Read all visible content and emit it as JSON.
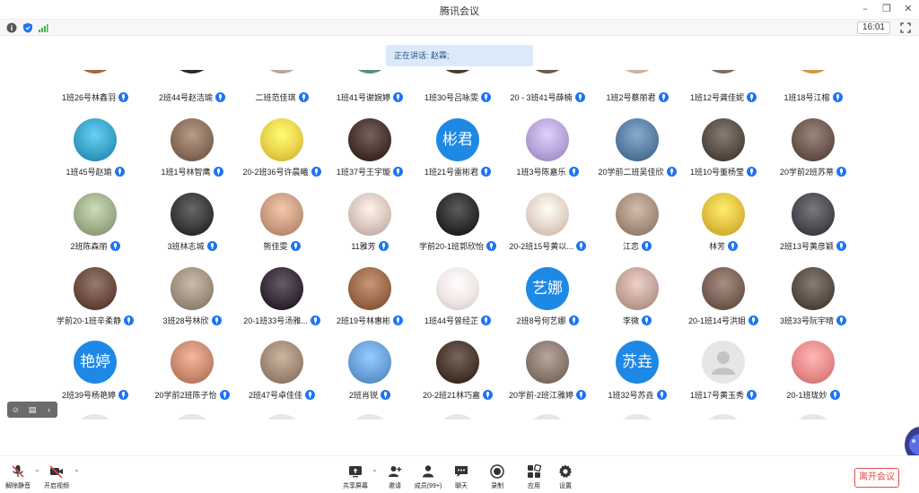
{
  "window": {
    "title": "腾讯会议",
    "minimize": "–",
    "restore": "❐",
    "close": "✕"
  },
  "status": {
    "time": "16:01"
  },
  "speaking": "正在讲话: 赵霖;",
  "colors": {
    "accent": "#1d74f5",
    "leave": "#e64a4a",
    "speaking_bg": "#dbe9fb"
  },
  "participants": [
    {
      "name": "1班26号林鑫羽",
      "avatar": "photo",
      "color": "#b9774a"
    },
    {
      "name": "2班44号赵洁瑜",
      "avatar": "photo",
      "color": "#3a3a3a"
    },
    {
      "name": "二班范佳琪",
      "avatar": "photo",
      "color": "#c5b9a6"
    },
    {
      "name": "1班41号谢婉婷",
      "avatar": "photo",
      "color": "#6e9b8c"
    },
    {
      "name": "1班30号吕咏雯",
      "avatar": "photo",
      "color": "#5a4a3d"
    },
    {
      "name": "20 - 3班41号薛楠",
      "avatar": "photo",
      "color": "#7c6a5e"
    },
    {
      "name": "1班2号蔡丽君",
      "avatar": "photo",
      "color": "#d9c2b0"
    },
    {
      "name": "1班12号龚佳妮",
      "avatar": "photo",
      "color": "#8f7f6d"
    },
    {
      "name": "1班18号江榕",
      "avatar": "photo",
      "color": "#e0a85a"
    },
    {
      "name": "1班45号赵瑜",
      "avatar": "photo",
      "color": "#3aa3c9"
    },
    {
      "name": "1班1号林智鹰",
      "avatar": "photo",
      "color": "#8b6f5d"
    },
    {
      "name": "20-2班36号许晨曦",
      "avatar": "photo",
      "color": "#e9d24a"
    },
    {
      "name": "1班37号王宇璇",
      "avatar": "photo",
      "color": "#4a3630"
    },
    {
      "name": "1班21号雷彬君",
      "avatar": "text",
      "text": "彬君"
    },
    {
      "name": "1班3号陈嘉乐",
      "avatar": "photo",
      "color": "#b4a4d9"
    },
    {
      "name": "20学前二班吴佳欣",
      "avatar": "photo",
      "color": "#5a7fa3"
    },
    {
      "name": "1班10号董杨莹",
      "avatar": "photo",
      "color": "#5a5048"
    },
    {
      "name": "20学前2班苏蒂",
      "avatar": "photo",
      "color": "#6e5a50"
    },
    {
      "name": "2班陈森丽",
      "avatar": "photo",
      "color": "#9fae8b"
    },
    {
      "name": "3班林志城",
      "avatar": "photo",
      "color": "#3b3b3b"
    },
    {
      "name": "熊佳雯",
      "avatar": "photo",
      "color": "#c99b80"
    },
    {
      "name": "11雅芳",
      "avatar": "photo",
      "color": "#d8c6bd"
    },
    {
      "name": "学前20-1班郭欣怡",
      "avatar": "photo",
      "color": "#2f2f2f"
    },
    {
      "name": "20-2班15号黄以...",
      "avatar": "photo",
      "color": "#e3d4c9"
    },
    {
      "name": "江恋",
      "avatar": "photo",
      "color": "#a8907e"
    },
    {
      "name": "林芳",
      "avatar": "photo",
      "color": "#e0c040"
    },
    {
      "name": "2班13号黄彦颖",
      "avatar": "photo",
      "color": "#4c4c52"
    },
    {
      "name": "学前20-1班辛柔静",
      "avatar": "photo",
      "color": "#6b4d42"
    },
    {
      "name": "3班28号林欣",
      "avatar": "photo",
      "color": "#a09080"
    },
    {
      "name": "20-1班33号汤雅...",
      "avatar": "photo",
      "color": "#3a2e3a"
    },
    {
      "name": "2班19号林惠彬",
      "avatar": "photo",
      "color": "#9a6a4a"
    },
    {
      "name": "1班44号曾经芷",
      "avatar": "photo",
      "color": "#f0e6e6"
    },
    {
      "name": "2班8号何艺娜",
      "avatar": "text",
      "text": "艺娜"
    },
    {
      "name": "李微",
      "avatar": "photo",
      "color": "#c2a49a"
    },
    {
      "name": "20-1班14号洪姐",
      "avatar": "photo",
      "color": "#7a6256"
    },
    {
      "name": "3班33号阮宇晴",
      "avatar": "photo",
      "color": "#5b5048"
    },
    {
      "name": "2班39号杨艳婷",
      "avatar": "text",
      "text": "艳婷"
    },
    {
      "name": "20学前2班陈子怡",
      "avatar": "photo",
      "color": "#c98a70"
    },
    {
      "name": "2班47号卓佳佳",
      "avatar": "photo",
      "color": "#a08a76"
    },
    {
      "name": "2班肖锐",
      "avatar": "photo",
      "color": "#6aa0d8"
    },
    {
      "name": "20-2班21林巧嘉",
      "avatar": "photo",
      "color": "#4a3a30"
    },
    {
      "name": "20学前-2班江雅婷",
      "avatar": "photo",
      "color": "#8a7a70"
    },
    {
      "name": "1班32号苏垚",
      "avatar": "text",
      "text": "苏垚"
    },
    {
      "name": "1班17号黄玉秀",
      "avatar": "blank"
    },
    {
      "name": "20-1班珑妙",
      "avatar": "photo",
      "color": "#e88a8a"
    }
  ],
  "toolbar": {
    "mute": "解除静音",
    "video": "开启视频",
    "share": "共享屏幕",
    "invite": "邀请",
    "members": "成员(99+)",
    "chat": "聊天",
    "record": "录制",
    "apps": "应用",
    "settings": "设置",
    "leave": "离开会议"
  }
}
